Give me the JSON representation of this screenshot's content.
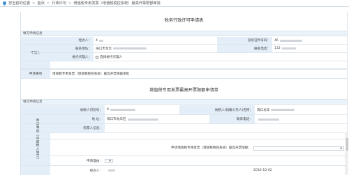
{
  "breadcrumb": {
    "location_label": "您当前的位置",
    "items": [
      "首页",
      "行政许可",
      "增值税专用发票（增值税税控系统）最高开票限额审批"
    ],
    "separator": ">"
  },
  "form1": {
    "title": "税务行政许可申请表",
    "section_label": "填写申请信息",
    "applicant_label": "申请人",
    "handler_label": "经办人：",
    "id_type_label": "身份证件号码：",
    "id_value_prefix": "46",
    "contact_addr_label": "联系地址：",
    "contact_addr_value": "海口市龙华",
    "contact_phone_label": "联系电话：",
    "contact_phone_value": "132",
    "agent_label": "委托代理人：",
    "agent_option": "选择委托代理人",
    "matter_label": "申请事项",
    "matter_value": "增值税专用发票（增值税税控系统）最高开票限额审批"
  },
  "form2": {
    "title": "增值税专用发票最高开票限额申请单",
    "section_label": "填写申请信息",
    "applicant_side_label": "申请事项（由纳税人填写）",
    "taxpayer_id_label": "纳税人识别号：",
    "taxpayer_id_value": "9",
    "taxpayer_name_label": "纳税人(扣缴义务人)名称：",
    "taxpayer_name_value": "海口龙华",
    "address_label": "地 址：",
    "address_value": "海口市龙华区",
    "phone_label": "联系电话：",
    "purchaser_label": "购票人信息：",
    "limit_label": "申请增值税专用发票（增值税税控系统）最高开票限额：",
    "reason_label": "申请理由：",
    "handler_label": "经办人：",
    "date_value": "2016-10-02"
  }
}
